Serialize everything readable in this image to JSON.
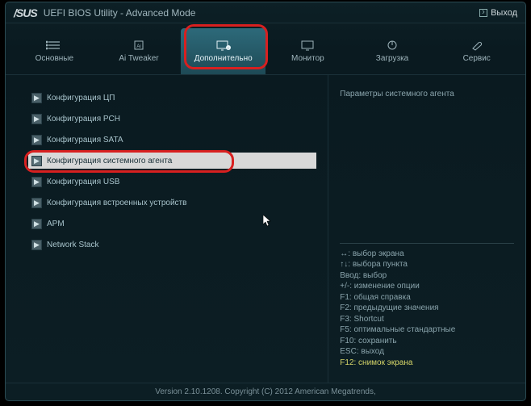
{
  "header": {
    "brand": "/SUS",
    "title": "UEFI BIOS Utility - Advanced Mode",
    "exit": "Выход"
  },
  "tabs": [
    {
      "label": "Основные"
    },
    {
      "label": "Ai Tweaker"
    },
    {
      "label": "Дополнительно"
    },
    {
      "label": "Монитор"
    },
    {
      "label": "Загрузка"
    },
    {
      "label": "Сервис"
    }
  ],
  "menu": [
    {
      "label": "Конфигурация ЦП"
    },
    {
      "label": "Конфигурация PCH"
    },
    {
      "label": "Конфигурация SATA"
    },
    {
      "label": "Конфигурация системного агента"
    },
    {
      "label": "Конфигурация USB"
    },
    {
      "label": "Конфигурация встроенных устройств"
    },
    {
      "label": "APM"
    },
    {
      "label": "Network Stack"
    }
  ],
  "side": {
    "title": "Параметры системного агента",
    "help": [
      {
        "t": "↔: выбор экрана",
        "y": false
      },
      {
        "t": "↑↓: выбора пункта",
        "y": false
      },
      {
        "t": "Ввод: выбор",
        "y": false
      },
      {
        "t": "+/-: изменение опции",
        "y": false
      },
      {
        "t": "F1: общая справка",
        "y": false
      },
      {
        "t": "F2: предыдущие значения",
        "y": false
      },
      {
        "t": "F3: Shortcut",
        "y": false
      },
      {
        "t": "F5: оптимальные стандартные",
        "y": false
      },
      {
        "t": "F10: сохранить",
        "y": false
      },
      {
        "t": "ESC: выход",
        "y": false
      },
      {
        "t": "F12: снимок экрана",
        "y": true
      }
    ]
  },
  "footer": "Version 2.10.1208. Copyright (C) 2012 American Megatrends,"
}
